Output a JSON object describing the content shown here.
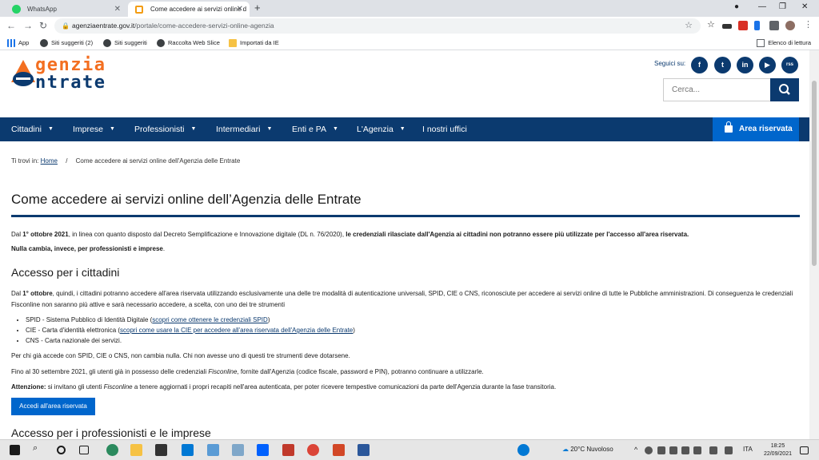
{
  "browser": {
    "tabs": [
      {
        "title": "WhatsApp",
        "active": false
      },
      {
        "title": "Come accedere ai servizi online d",
        "active": true
      }
    ],
    "url_host": "agenziaentrate.gov.it",
    "url_path": "/portale/come-accedere-servizi-online-agenzia",
    "bookmarks": [
      "App",
      "Siti suggeriti (2)",
      "Siti suggeriti",
      "Raccolta Web Slice",
      "Importati da IE"
    ],
    "reading_list": "Elenco di lettura"
  },
  "site": {
    "logo_line1": "genzia",
    "logo_line2": "ntrate",
    "social_label": "Seguici su:",
    "social": [
      "f",
      "t",
      "in",
      "▶",
      "rss"
    ],
    "search_placeholder": "Cerca...",
    "nav": [
      "Cittadini",
      "Imprese",
      "Professionisti",
      "Intermediari",
      "Enti e PA",
      "L'Agenzia",
      "I nostri uffici"
    ],
    "area_riservata": "Area riservata"
  },
  "breadcrumb": {
    "prefix": "Ti trovi in:",
    "home": "Home",
    "current": "Come accedere ai servizi online dell'Agenzia delle Entrate"
  },
  "article": {
    "title": "Come accedere ai servizi online dell’Agenzia delle Entrate",
    "intro_a": "Dal ",
    "intro_date": "1° ottobre 2021",
    "intro_b": ", in linea con quanto disposto dal Decreto Semplificazione e Innovazione digitale (DL n. 76/2020), ",
    "intro_bold": "le credenziali rilasciate dall'Agenzia ai cittadini non potranno essere più utilizzate per l'accesso all'area riservata.",
    "intro2": "Nulla cambia, invece, per professionisti e imprese",
    "intro2_end": ".",
    "h2_cittadini": "Accesso per i cittadini",
    "p1_a": "Dal ",
    "p1_date": "1° ottobre",
    "p1_b": ", quindi, i cittadini potranno accedere all'area riservata utilizzando esclusivamente una delle tre modalità di autenticazione universali, SPID, CIE o CNS, riconosciute per accedere ai servizi online di tutte le Pubbliche amministrazioni. Di conseguenza le credenziali Fisconline non saranno più attive e sarà necessario accedere, a scelta, con uno dei tre strumenti",
    "list": [
      {
        "text": "SPID - Sistema Pubblico di Identità Digitale (",
        "link": "scopri come ottenere le credenziali SPID",
        "end": ")"
      },
      {
        "text": "CIE - Carta d'identità elettronica (",
        "link": "scopri come usare la CIE per accedere all'area riservata dell'Agenzia delle Entrate",
        "end": ")"
      },
      {
        "text": "CNS - Carta nazionale dei servizi.",
        "link": "",
        "end": ""
      }
    ],
    "p2": "Per chi già accede con SPID, CIE o CNS, non cambia nulla. Chi non avesse uno di questi tre strumenti deve dotarsene.",
    "p3_a": "Fino al 30 settembre 2021, gli utenti già in possesso delle credenziali ",
    "p3_italic": "Fisconline",
    "p3_b": ", fornite dall'Agenzia (codice fiscale, password e PIN), potranno continuare a utilizzarle.",
    "p4_bold": "Attenzione:",
    "p4_a": " si invitano gli utenti ",
    "p4_italic": "Fisconline",
    "p4_b": " a tenere aggiornati i propri recapiti nell'area autenticata, per poter ricevere tempestive comunicazioni da parte dell'Agenzia durante la fase transitoria.",
    "button": "Accedi all'area riservata",
    "h2_prof": "Accesso per i professionisti e le imprese"
  },
  "taskbar": {
    "weather": "20°C  Nuvoloso",
    "lang": "ITA",
    "time": "18:25",
    "date": "22/09/2021"
  }
}
